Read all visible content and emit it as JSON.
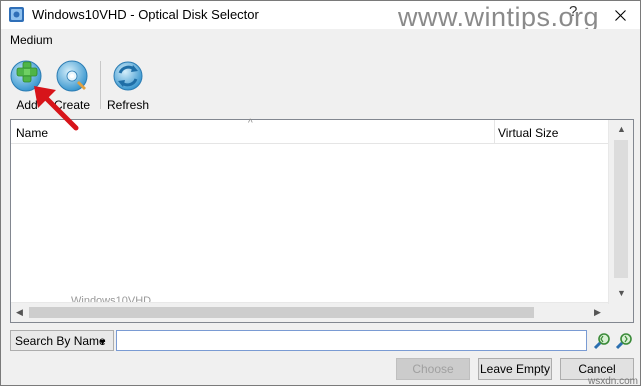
{
  "window": {
    "title": "Windows10VHD - Optical Disk Selector",
    "close_glyph": "✕",
    "help_glyph": "?"
  },
  "watermark": "www.wintips.org",
  "watermark_bottom": "wsxdn.com",
  "menubar": {
    "items": [
      {
        "label": "Medium"
      }
    ]
  },
  "toolbar": {
    "add_label": "Add",
    "create_label": "Create",
    "refresh_label": "Refresh",
    "icons": {
      "add": "add-disk-icon",
      "create": "create-disk-icon",
      "refresh": "refresh-icon"
    }
  },
  "table": {
    "columns": [
      {
        "label": "Name"
      },
      {
        "label": "Virtual Size"
      }
    ],
    "rows": [],
    "ghost_row": "Windows10VHD"
  },
  "search": {
    "mode": "Search By Name",
    "value": ""
  },
  "buttons": {
    "choose": "Choose",
    "leave_empty": "Leave Empty",
    "cancel": "Cancel"
  },
  "colors": {
    "arrow": "#d7141a",
    "add_icon_green": "#4fb548",
    "disk_blue": "#4aa8d8"
  }
}
